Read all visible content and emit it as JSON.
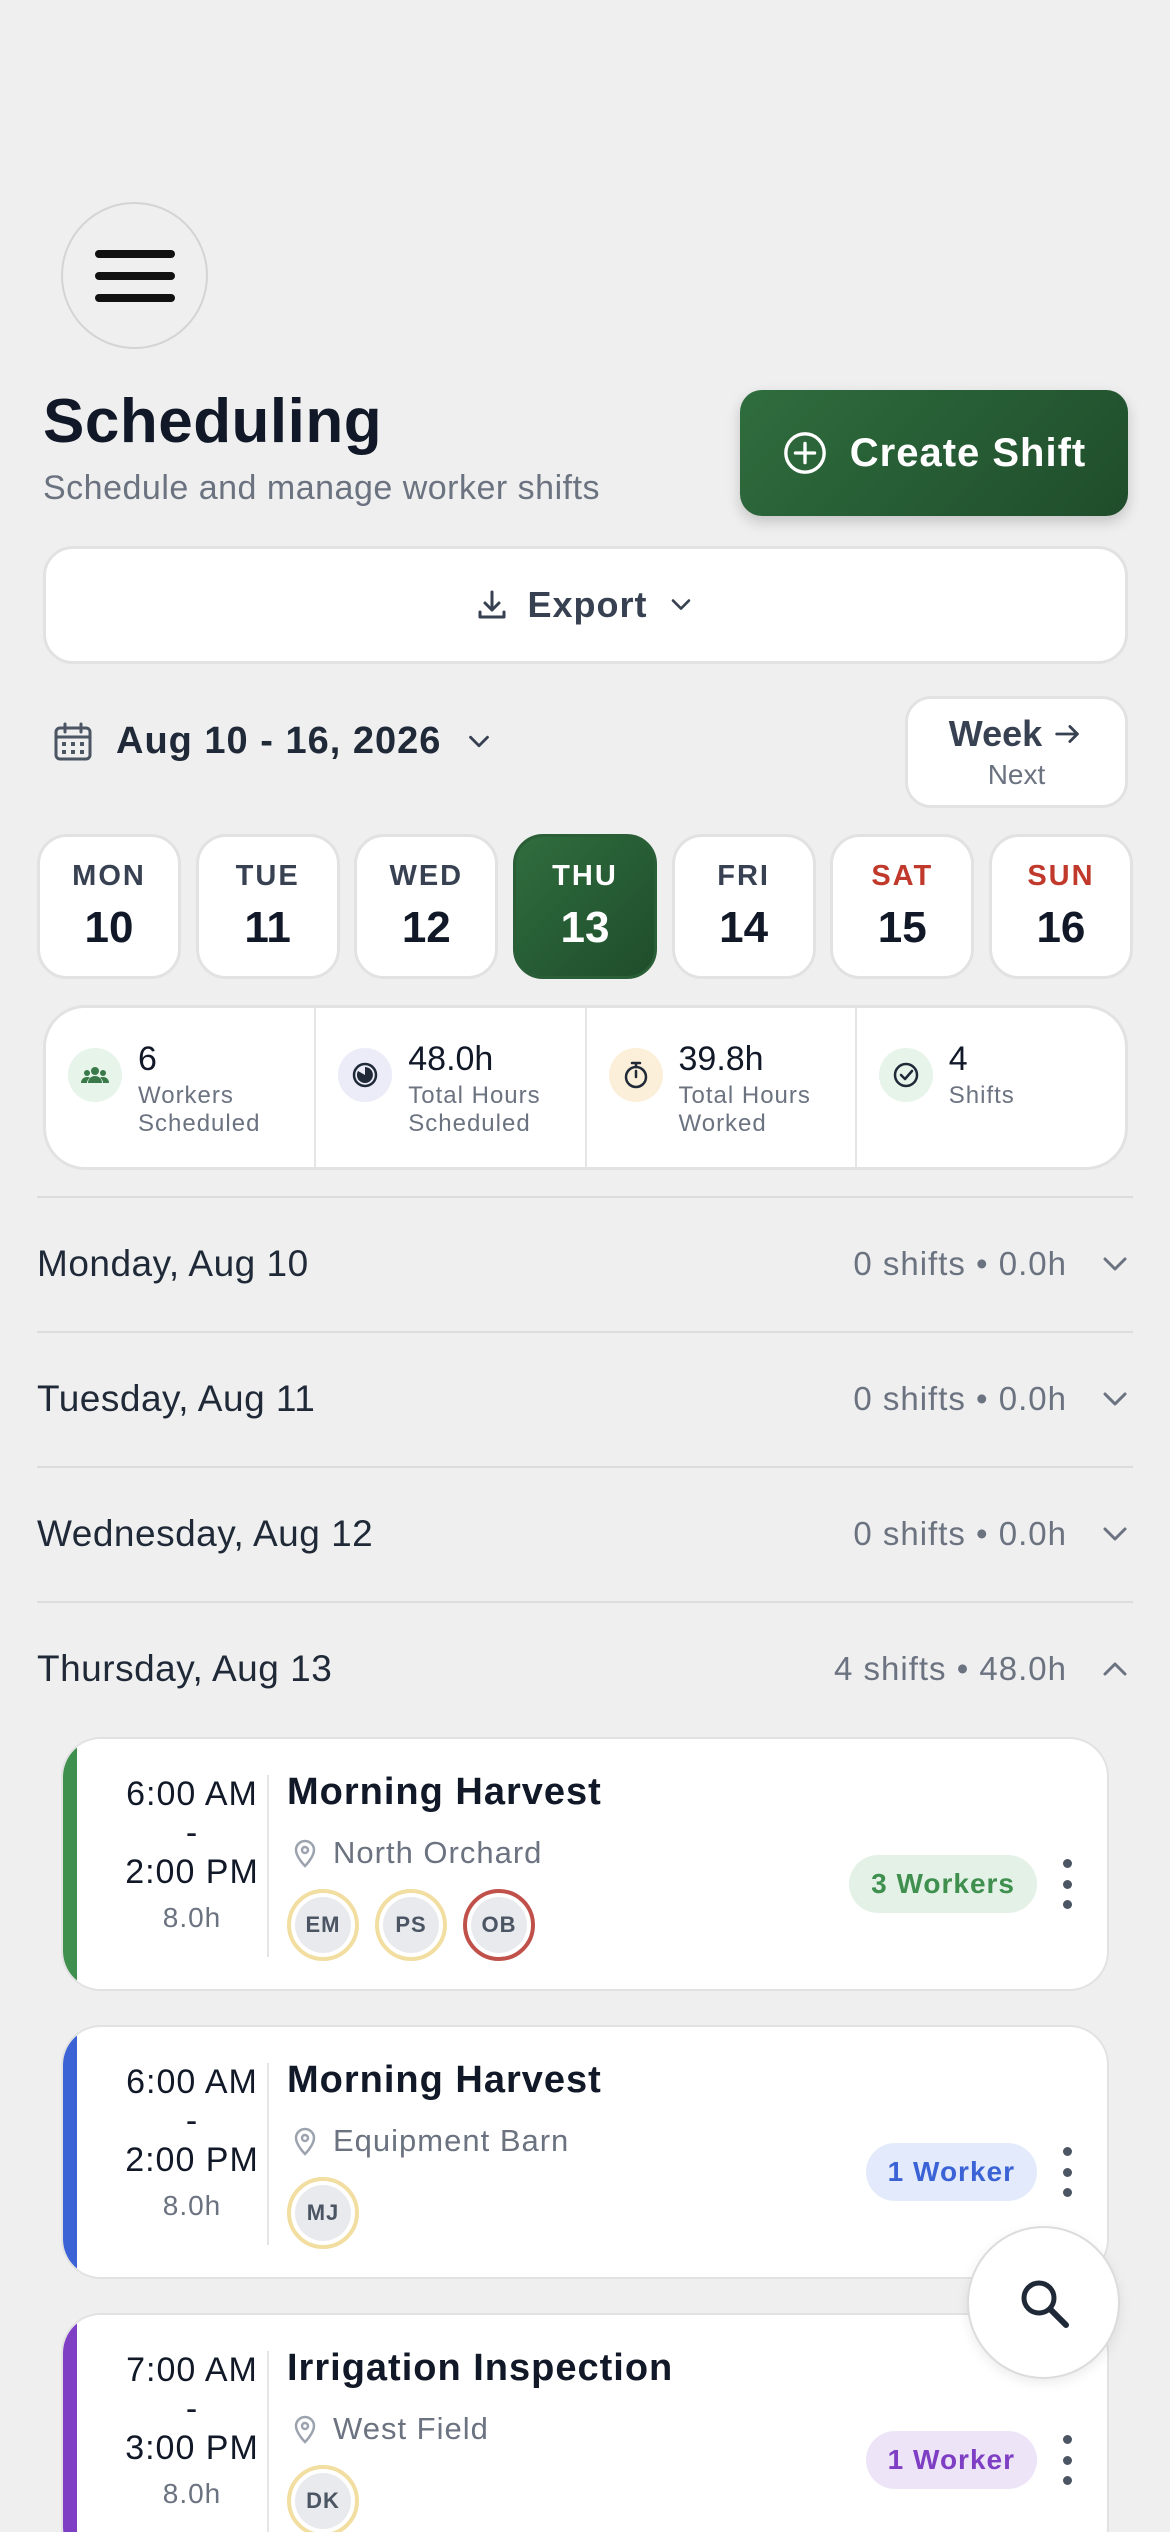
{
  "header": {
    "title": "Scheduling",
    "subtitle": "Schedule and manage worker shifts",
    "create_label": "Create Shift"
  },
  "export": {
    "label": "Export"
  },
  "week": {
    "range_label": "Aug 10 - 16, 2026",
    "nav_label": "Week",
    "nav_sub": "Next",
    "days": [
      {
        "name": "MON",
        "date": "10"
      },
      {
        "name": "TUE",
        "date": "11"
      },
      {
        "name": "WED",
        "date": "12"
      },
      {
        "name": "THU",
        "date": "13"
      },
      {
        "name": "FRI",
        "date": "14"
      },
      {
        "name": "SAT",
        "date": "15"
      },
      {
        "name": "SUN",
        "date": "16"
      }
    ]
  },
  "stats": [
    {
      "value": "6",
      "label1": "Workers",
      "label2": "Scheduled",
      "icon": "people-icon",
      "bg": "#e6f4ea",
      "color": "#3a7a4a"
    },
    {
      "value": "48.0h",
      "label1": "Total Hours",
      "label2": "Scheduled",
      "icon": "clock-pie-icon",
      "bg": "#ecebf8",
      "color": "#1f2937"
    },
    {
      "value": "39.8h",
      "label1": "Total Hours",
      "label2": "Worked",
      "icon": "stopwatch-icon",
      "bg": "#fcefd9",
      "color": "#1f2937"
    },
    {
      "value": "4",
      "label1": "Shifts",
      "label2": "",
      "icon": "check-circle-icon",
      "bg": "#e6f4ea",
      "color": "#1f2937"
    }
  ],
  "day_rows": [
    {
      "name": "Monday, Aug 10",
      "summary": "0 shifts • 0.0h",
      "expanded": false
    },
    {
      "name": "Tuesday, Aug 11",
      "summary": "0 shifts • 0.0h",
      "expanded": false
    },
    {
      "name": "Wednesday, Aug 12",
      "summary": "0 shifts • 0.0h",
      "expanded": false
    },
    {
      "name": "Thursday, Aug 13",
      "summary": "4 shifts • 48.0h",
      "expanded": true
    }
  ],
  "shifts": [
    {
      "start": "6:00 AM",
      "dash": "-",
      "end": "2:00 PM",
      "hours": "8.0h",
      "name": "Morning Harvest",
      "location": "North Orchard",
      "badge": "3 Workers",
      "accent": "#3f8f4f",
      "badge_bg": "#e3f1e6",
      "badge_color": "#3f8f4f",
      "workers": [
        "EM",
        "PS",
        "OB"
      ]
    },
    {
      "start": "6:00 AM",
      "dash": "-",
      "end": "2:00 PM",
      "hours": "8.0h",
      "name": "Morning Harvest",
      "location": "Equipment Barn",
      "badge": "1 Worker",
      "accent": "#3b63d6",
      "badge_bg": "#e3eafb",
      "badge_color": "#3b63d6",
      "workers": [
        "MJ"
      ]
    },
    {
      "start": "7:00 AM",
      "dash": "-",
      "end": "3:00 PM",
      "hours": "8.0h",
      "name": "Irrigation Inspection",
      "location": "West Field",
      "badge": "1 Worker",
      "accent": "#7e3fc4",
      "badge_bg": "#ede4f8",
      "badge_color": "#7e3fc4",
      "workers": [
        "DK"
      ]
    }
  ]
}
